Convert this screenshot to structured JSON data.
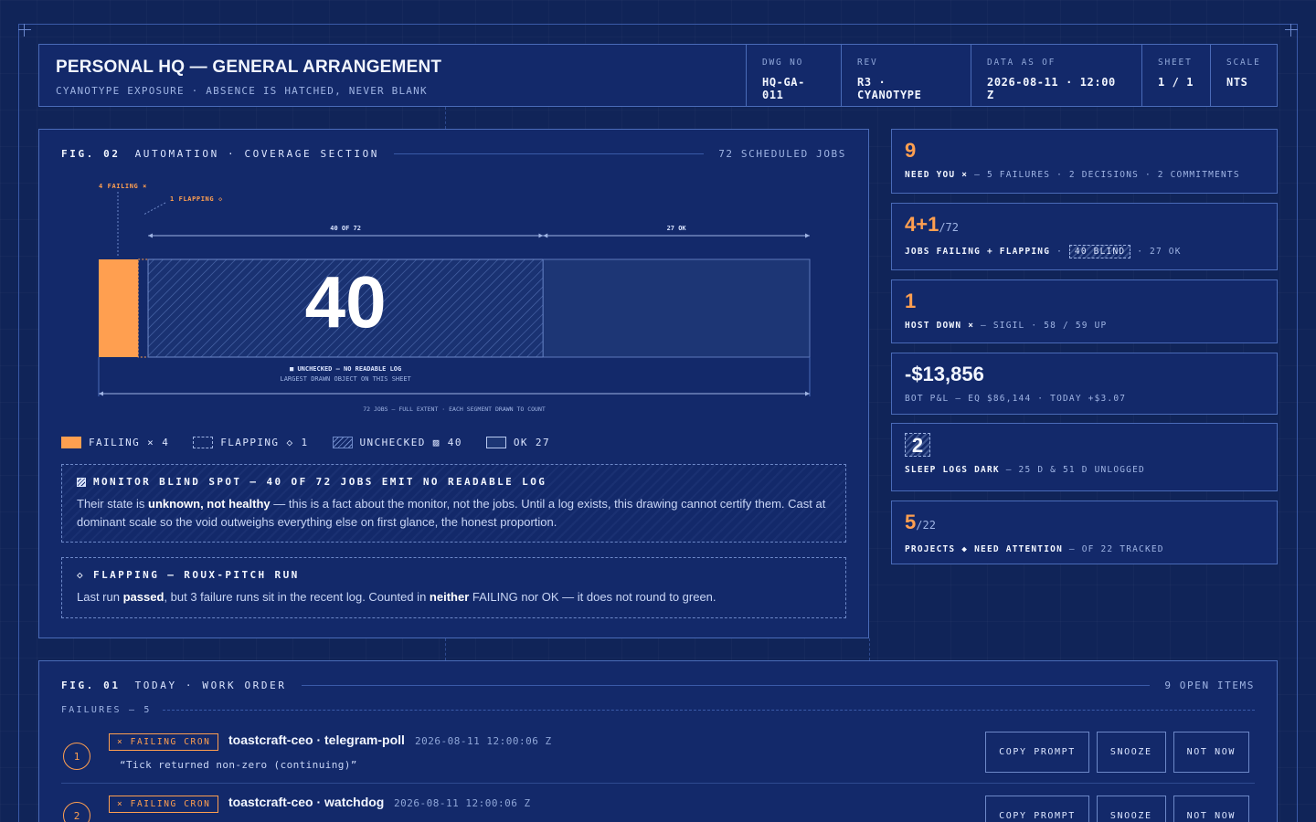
{
  "titleblock": {
    "title": "PERSONAL HQ — GENERAL ARRANGEMENT",
    "subtitle": "CYANOTYPE EXPOSURE · ABSENCE IS HATCHED, NEVER BLANK",
    "cells": [
      {
        "key": "DWG NO",
        "value": "HQ-GA-011"
      },
      {
        "key": "REV",
        "value": "R3 · CYANOTYPE"
      },
      {
        "key": "DATA AS OF",
        "value": "2026-08-11 · 12:00 Z"
      },
      {
        "key": "SHEET",
        "value": "1 / 1"
      },
      {
        "key": "SCALE",
        "value": "NTS"
      }
    ]
  },
  "coverage": {
    "fig_no": "FIG. 02",
    "fig_title": "AUTOMATION · COVERAGE SECTION",
    "fig_right": "72 SCHEDULED JOBS",
    "annot_failing": "4 FAILING ×",
    "annot_flapping": "1 FLAPPING ◇",
    "dim_unchecked": "40 OF 72",
    "dim_ok": "27 OK",
    "big_number": "40",
    "caption_1": "■ UNCHECKED — NO READABLE LOG",
    "caption_2": "LARGEST DRAWN OBJECT ON THIS SHEET",
    "extent_label": "72 JOBS — FULL EXTENT · EACH SEGMENT DRAWN TO COUNT",
    "segments": {
      "total": 72,
      "failing": 4,
      "flapping": 1,
      "unchecked": 40,
      "ok": 27
    },
    "legend": [
      {
        "label": "FAILING × 4"
      },
      {
        "label": "FLAPPING ◇ 1"
      },
      {
        "label": "UNCHECKED ▨ 40"
      },
      {
        "label": "OK 27"
      }
    ],
    "note_blind": {
      "title": "MONITOR BLIND SPOT — 40 OF 72 JOBS EMIT NO READABLE LOG",
      "body_pre": "Their state is ",
      "body_bold": "unknown, not healthy",
      "body_post": " — this is a fact about the monitor, not the jobs. Until a log exists, this drawing cannot certify them. Cast at dominant scale so the void outweighs everything else on first glance, the honest proportion."
    },
    "note_flap": {
      "title": "◇ FLAPPING — ROUX-PITCH RUN",
      "body_1": "Last run ",
      "body_bold_1": "passed",
      "body_2": ", but 3 failure runs sit in the recent log. Counted in ",
      "body_bold_2": "neither",
      "body_3": " FAILING nor OK — it does not round to green."
    }
  },
  "cards": {
    "need_you": {
      "big": "9",
      "label": "NEED YOU ×",
      "detail": " — 5 FAILURES · 2 DECISIONS · 2 COMMITMENTS"
    },
    "jobs": {
      "big": "4+1",
      "of": "/72",
      "label": "JOBS FAILING + FLAPPING",
      "sep": " · ",
      "blind": "40 BLIND",
      "ok": " · 27 OK"
    },
    "host": {
      "big": "1",
      "label": "HOST DOWN ×",
      "detail": " — SIGIL · 58 / 59 UP"
    },
    "pnl": {
      "big": "-$13,856",
      "detail": "BOT P&L — EQ $86,144 · TODAY +$3.07"
    },
    "sleep": {
      "big": "2",
      "label": "SLEEP LOGS DARK",
      "detail": " — 25 D & 51 D UNLOGGED"
    },
    "projects": {
      "big": "5",
      "of": "/22",
      "label": "PROJECTS ◆ NEED ATTENTION",
      "detail": " — OF 22 TRACKED"
    }
  },
  "workorder": {
    "fig_no": "FIG. 01",
    "fig_title": "TODAY · WORK ORDER",
    "fig_right": "9 OPEN ITEMS",
    "section": "FAILURES — 5",
    "buttons": {
      "copy": "COPY PROMPT",
      "snooze": "SNOOZE",
      "not_now": "NOT NOW"
    },
    "rows": [
      {
        "num": "1",
        "tag": "× FAILING CRON",
        "title": "toastcraft-ceo · telegram-poll",
        "ts": "2026-08-11 12:00:06 Z",
        "quote": "“Tick returned non-zero (continuing)”"
      },
      {
        "num": "2",
        "tag": "× FAILING CRON",
        "title": "toastcraft-ceo · watchdog",
        "ts": "2026-08-11 12:00:06 Z",
        "quote": ""
      }
    ]
  },
  "colors": {
    "accent": "#ff9f50",
    "background": "#102458",
    "panel": "#13296a",
    "line": "#4a6bb8"
  }
}
